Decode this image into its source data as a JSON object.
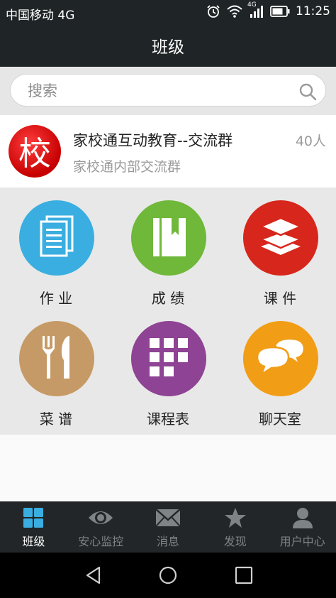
{
  "status_bar": {
    "carrier": "中国移动 4G",
    "network_small": "4G",
    "time": "11:25"
  },
  "header": {
    "title": "班级"
  },
  "search": {
    "placeholder": "搜索",
    "value": ""
  },
  "group": {
    "avatar_char": "校",
    "name": "家校通互动教育--交流群",
    "description": "家校通内部交流群",
    "member_count": "40人"
  },
  "features": [
    {
      "label": "作 业",
      "icon": "homework-document-icon",
      "color": "#3aaee0"
    },
    {
      "label": "成 绩",
      "icon": "grades-book-icon",
      "color": "#6fb83a"
    },
    {
      "label": "课 件",
      "icon": "courseware-layers-icon",
      "color": "#d7261b"
    },
    {
      "label": "菜 谱",
      "icon": "menu-fork-knife-icon",
      "color": "#c69a66"
    },
    {
      "label": "课程表",
      "icon": "schedule-grid-icon",
      "color": "#8e4394"
    },
    {
      "label": "聊天室",
      "icon": "chat-bubbles-icon",
      "color": "#f29d16"
    }
  ],
  "tabs": [
    {
      "label": "班级",
      "icon": "class-grid-icon",
      "active": true
    },
    {
      "label": "安心监控",
      "icon": "eye-icon",
      "active": false
    },
    {
      "label": "消息",
      "icon": "envelope-icon",
      "active": false
    },
    {
      "label": "发现",
      "icon": "star-icon",
      "active": false
    },
    {
      "label": "用户中心",
      "icon": "user-icon",
      "active": false
    }
  ],
  "colors": {
    "bar_dark": "#1f2426",
    "tab_active": "#ffffff",
    "tab_inactive": "#7e8386",
    "avatar_red": "#d40000"
  }
}
